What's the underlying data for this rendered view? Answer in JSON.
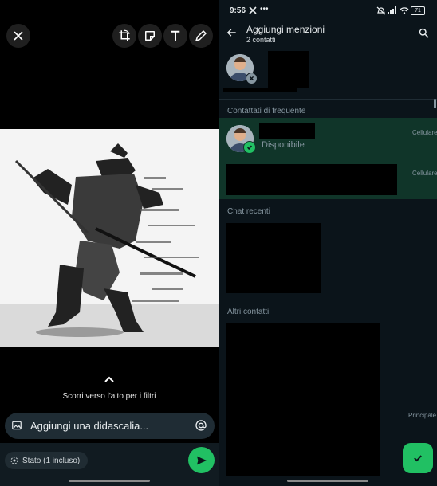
{
  "left": {
    "swipe_hint": "Scorri verso l'alto per i filtri",
    "caption_placeholder": "Aggiungi una didascalia...",
    "status_label": "Stato (1 incluso)"
  },
  "right": {
    "status_bar": {
      "time": "9:56",
      "battery": "71"
    },
    "header": {
      "title": "Aggiungi menzioni",
      "subtitle": "2 contatti"
    },
    "sections": {
      "frequent": "Contattati di frequente",
      "recent": "Chat recenti",
      "others": "Altri contatti"
    },
    "frequent_contacts": [
      {
        "status": "Disponibile",
        "type": "Cellulare"
      },
      {
        "status": "",
        "type": "Cellulare"
      }
    ],
    "other_contact_type": "Principale"
  },
  "colors": {
    "accent_green": "#21c063",
    "selected_row": "#103529",
    "panel_dark": "#0b141a"
  }
}
